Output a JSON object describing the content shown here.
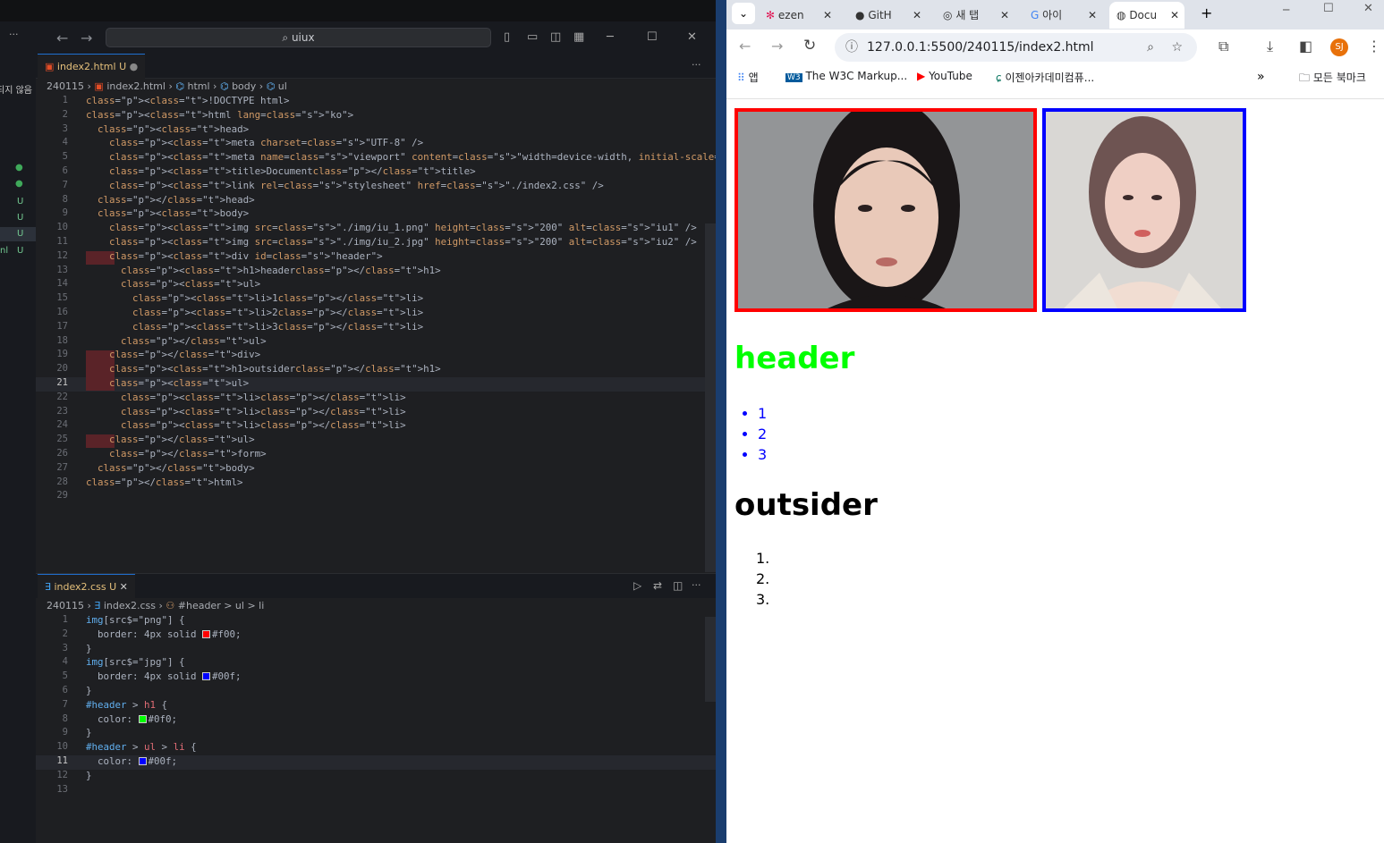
{
  "vscode": {
    "search_text": "uiux",
    "sidebar_label": "되지 않음",
    "sidebar_badges": [
      "U",
      "U",
      "U",
      "U",
      "U"
    ],
    "sidebar_suffix": "nl",
    "html_tab": {
      "name": "index2.html",
      "status": "U"
    },
    "html_breadcrumb": [
      "240115",
      "index2.html",
      "html",
      "body",
      "ul"
    ],
    "html_lines": [
      "<!DOCTYPE html>",
      "<html lang=\"ko\">",
      "  <head>",
      "    <meta charset=\"UTF-8\" />",
      "    <meta name=\"viewport\" content=\"width=device-width, initial-scale=1.0\" />",
      "    <title>Document</title>",
      "    <link rel=\"stylesheet\" href=\"./index2.css\" />",
      "  </head>",
      "  <body>",
      "    <img src=\"./img/iu_1.png\" height=\"200\" alt=\"iu1\" />",
      "    <img src=\"./img/iu_2.jpg\" height=\"200\" alt=\"iu2\" />",
      "    <div id=\"header\">",
      "      <h1>header</h1>",
      "      <ul>",
      "        <li>1</li>",
      "        <li>2</li>",
      "        <li>3</li>",
      "      </ul>",
      "    </div>",
      "    <h1>outsider</h1>",
      "    <ul>",
      "      <li></li>",
      "      <li></li>",
      "      <li></li>",
      "    </ul>",
      "    </form>",
      "  </body>",
      "</html>",
      ""
    ],
    "html_current_line": "21",
    "css_tab": {
      "name": "index2.css",
      "status": "U"
    },
    "css_breadcrumb": [
      "240115",
      "index2.css",
      "#header > ul > li"
    ],
    "css_lines": [
      "img[src$=\"png\"] {",
      "  border: 4px solid #f00;",
      "}",
      "img[src$=\"jpg\"] {",
      "  border: 4px solid #00f;",
      "}",
      "#header > h1 {",
      "  color: #0f0;",
      "}",
      "#header > ul > li {",
      "  color: #00f;",
      "}",
      ""
    ],
    "css_current_line": "11"
  },
  "chrome": {
    "tabs": [
      "ezen",
      "GitH",
      "새 탭",
      "아이",
      "Docu"
    ],
    "url": "127.0.0.1:5500/240115/index2.html",
    "bookmarks": [
      "앱",
      "The W3C Markup...",
      "YouTube",
      "이젠아카데미컴퓨...",
      "모든 북마크"
    ],
    "profile": "SJ",
    "page": {
      "header_h1": "header",
      "header_list": [
        "1",
        "2",
        "3"
      ],
      "outsider_h1": "outsider",
      "outsider_list": [
        "1.",
        "2.",
        "3."
      ],
      "img1_alt": "iu1",
      "img2_alt": "iu2",
      "colors": {
        "png_border": "#ff0000",
        "jpg_border": "#0000ff",
        "header": "#00ff00",
        "list": "#0000ff"
      }
    }
  }
}
